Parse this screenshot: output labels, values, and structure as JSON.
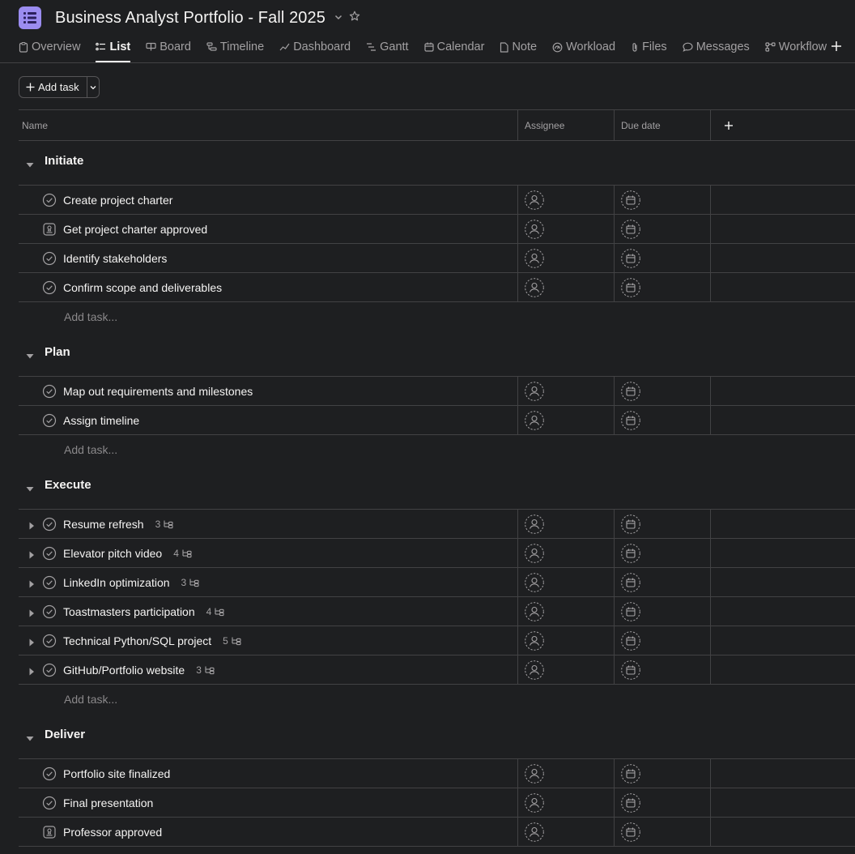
{
  "project": {
    "title": "Business Analyst Portfolio - Fall 2025",
    "icon": "list-icon",
    "accent": "#9b8cf0"
  },
  "tabs": [
    {
      "label": "Overview",
      "icon": "overview-icon",
      "active": false
    },
    {
      "label": "List",
      "icon": "list-icon",
      "active": true
    },
    {
      "label": "Board",
      "icon": "board-icon",
      "active": false
    },
    {
      "label": "Timeline",
      "icon": "timeline-icon",
      "active": false
    },
    {
      "label": "Dashboard",
      "icon": "dashboard-icon",
      "active": false
    },
    {
      "label": "Gantt",
      "icon": "gantt-icon",
      "active": false
    },
    {
      "label": "Calendar",
      "icon": "calendar-icon",
      "active": false
    },
    {
      "label": "Note",
      "icon": "note-icon",
      "active": false
    },
    {
      "label": "Workload",
      "icon": "workload-icon",
      "active": false
    },
    {
      "label": "Files",
      "icon": "paperclip-icon",
      "active": false
    },
    {
      "label": "Messages",
      "icon": "message-icon",
      "active": false
    },
    {
      "label": "Workflow",
      "icon": "workflow-icon",
      "active": false
    }
  ],
  "toolbar": {
    "add_task_label": "Add task"
  },
  "columns": {
    "name": "Name",
    "assignee": "Assignee",
    "due_date": "Due date"
  },
  "add_task_row_label": "Add task...",
  "sections": [
    {
      "name": "Initiate",
      "tasks": [
        {
          "name": "Create project charter",
          "kind": "task"
        },
        {
          "name": "Get project charter approved",
          "kind": "approval"
        },
        {
          "name": "Identify stakeholders",
          "kind": "task"
        },
        {
          "name": "Confirm scope and deliverables",
          "kind": "task"
        }
      ]
    },
    {
      "name": "Plan",
      "tasks": [
        {
          "name": "Map out requirements and milestones",
          "kind": "task"
        },
        {
          "name": "Assign timeline",
          "kind": "task"
        }
      ]
    },
    {
      "name": "Execute",
      "tasks": [
        {
          "name": "Resume refresh",
          "kind": "task",
          "subtasks": "3"
        },
        {
          "name": "Elevator pitch video",
          "kind": "task",
          "subtasks": "4"
        },
        {
          "name": "LinkedIn optimization",
          "kind": "task",
          "subtasks": "3"
        },
        {
          "name": "Toastmasters participation",
          "kind": "task",
          "subtasks": "4"
        },
        {
          "name": "Technical Python/SQL project",
          "kind": "task",
          "subtasks": "5"
        },
        {
          "name": "GitHub/Portfolio website",
          "kind": "task",
          "subtasks": "3"
        }
      ]
    },
    {
      "name": "Deliver",
      "tasks": [
        {
          "name": "Portfolio site finalized",
          "kind": "task"
        },
        {
          "name": "Final presentation",
          "kind": "task"
        },
        {
          "name": "Professor approved",
          "kind": "approval"
        }
      ]
    }
  ]
}
